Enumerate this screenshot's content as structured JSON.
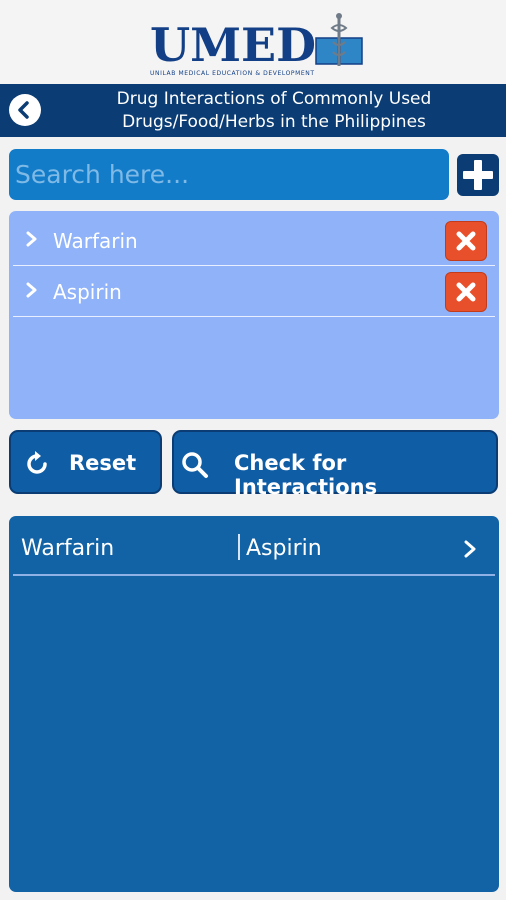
{
  "header": {
    "logo_text": "UMED",
    "logo_subtitle": "UNILAB MEDICAL EDUCATION & DEVELOPMENT",
    "title_line1": "Drug Interactions of Commonly Used",
    "title_line2": "Drugs/Food/Herbs in the Philippines"
  },
  "search": {
    "placeholder": "Search here...",
    "value": ""
  },
  "selected": {
    "items": [
      {
        "label": "Warfarin"
      },
      {
        "label": "Aspirin"
      }
    ]
  },
  "actions": {
    "reset_label": "Reset",
    "check_label": "Check for Interactions"
  },
  "results": {
    "rows": [
      {
        "drug_a": "Warfarin",
        "drug_b": "Aspirin"
      }
    ]
  },
  "colors": {
    "brand": "#0b3c73",
    "search_bg": "#127cc9",
    "list_bg": "#8fb2f8",
    "remove": "#e8502b",
    "result_bg": "#1163a6"
  }
}
